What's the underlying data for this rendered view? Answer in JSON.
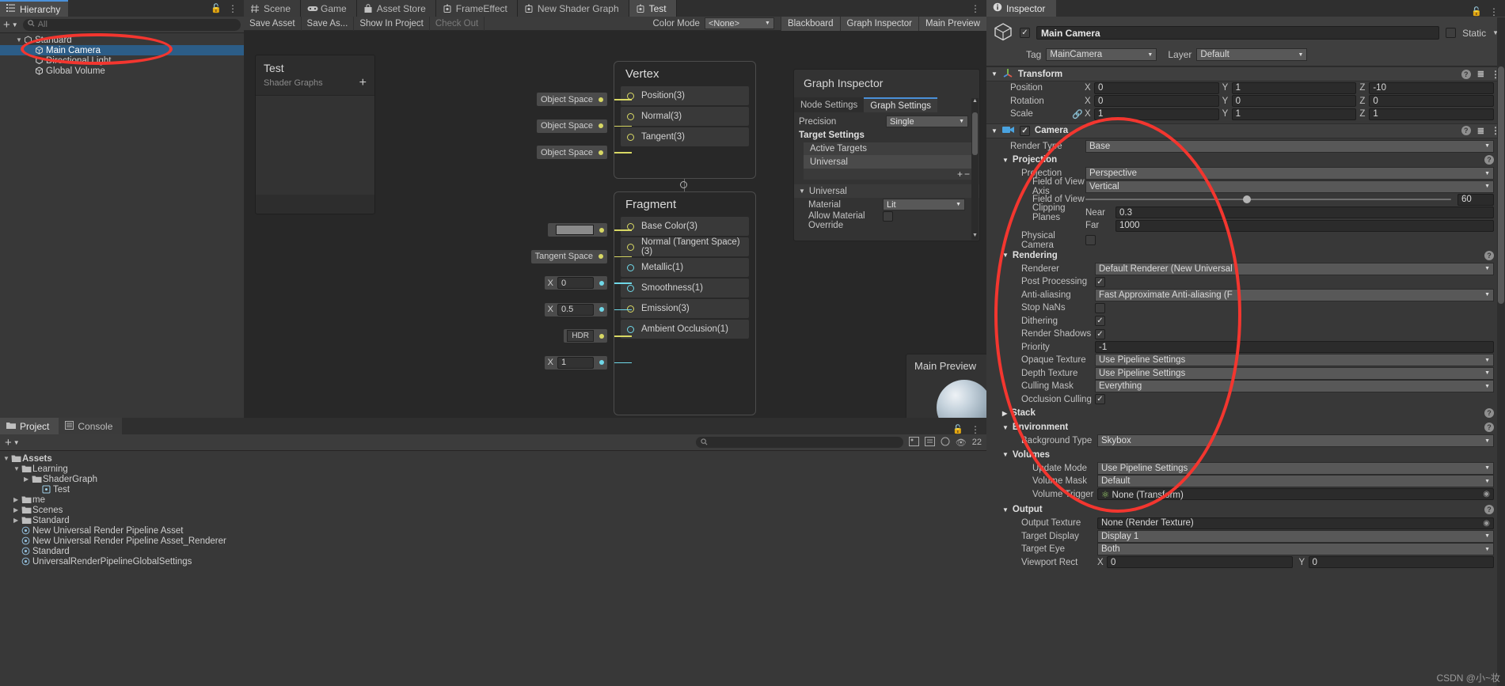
{
  "hierarchy": {
    "tab_label": "Hierarchy",
    "search_placeholder": "All",
    "add_label": "+",
    "items": [
      {
        "label": "Standard",
        "depth": 0,
        "icon": "scene-icon",
        "expanded": true,
        "selected": false
      },
      {
        "label": "Main Camera",
        "depth": 1,
        "icon": "gameobject-icon",
        "expanded": false,
        "selected": true
      },
      {
        "label": "Directional Light",
        "depth": 1,
        "icon": "light-icon",
        "expanded": false,
        "selected": false
      },
      {
        "label": "Global Volume",
        "depth": 1,
        "icon": "gameobject-icon",
        "expanded": false,
        "selected": false
      }
    ]
  },
  "editor_tabs": [
    {
      "label": "Scene",
      "icon": "scene-icon",
      "active": false
    },
    {
      "label": "Game",
      "icon": "game-icon",
      "active": false
    },
    {
      "label": "Asset Store",
      "icon": "store-icon",
      "active": false
    },
    {
      "label": "FrameEffect",
      "icon": "shadergraph-icon",
      "active": false
    },
    {
      "label": "New Shader Graph",
      "icon": "shadergraph-icon",
      "active": false
    },
    {
      "label": "Test",
      "icon": "shadergraph-icon",
      "active": true
    }
  ],
  "shadergraph": {
    "toolbar": {
      "save_asset": "Save Asset",
      "save_as": "Save As...",
      "show_in_project": "Show In Project",
      "check_out": "Check Out",
      "color_mode_label": "Color Mode",
      "color_mode_value": "<None>",
      "blackboard_toggle": "Blackboard",
      "graph_inspector_toggle": "Graph Inspector",
      "main_preview_toggle": "Main Preview"
    },
    "blackboard": {
      "title": "Test",
      "subtitle": "Shader Graphs",
      "add_label": "+"
    },
    "vertex_node": {
      "title": "Vertex",
      "ports": [
        {
          "name": "Position(3)",
          "input_label": "Object Space",
          "type": "vector"
        },
        {
          "name": "Normal(3)",
          "input_label": "Object Space",
          "type": "vector"
        },
        {
          "name": "Tangent(3)",
          "input_label": "Object Space",
          "type": "vector"
        }
      ]
    },
    "fragment_node": {
      "title": "Fragment",
      "ports": [
        {
          "name": "Base Color(3)",
          "input_kind": "color",
          "input_label": "",
          "type": "vector"
        },
        {
          "name": "Normal (Tangent Space)(3)",
          "input_kind": "text",
          "input_label": "Tangent Space",
          "type": "vector"
        },
        {
          "name": "Metallic(1)",
          "input_kind": "float",
          "input_label": "X",
          "value": "0",
          "type": "float"
        },
        {
          "name": "Smoothness(1)",
          "input_kind": "float",
          "input_label": "X",
          "value": "0.5",
          "type": "float"
        },
        {
          "name": "Emission(3)",
          "input_kind": "hdr",
          "input_label": "HDR",
          "type": "vector"
        },
        {
          "name": "Ambient Occlusion(1)",
          "input_kind": "float",
          "input_label": "X",
          "value": "1",
          "type": "float"
        }
      ]
    },
    "graph_inspector": {
      "title": "Graph Inspector",
      "tabs": [
        {
          "label": "Node Settings",
          "active": false
        },
        {
          "label": "Graph Settings",
          "active": true
        }
      ],
      "precision_label": "Precision",
      "precision_value": "Single",
      "target_settings_label": "Target Settings",
      "active_targets_label": "Active Targets",
      "active_target_value": "Universal",
      "add_btn": "+",
      "remove_btn": "−",
      "universal_section": "Universal",
      "material_label": "Material",
      "material_value": "Lit",
      "allow_material_override_label": "Allow Material Override"
    },
    "main_preview": {
      "title": "Main Preview"
    }
  },
  "project": {
    "tabs": [
      {
        "label": "Project",
        "icon": "folder-icon",
        "active": true
      },
      {
        "label": "Console",
        "icon": "console-icon",
        "active": false
      }
    ],
    "add_label": "+",
    "search_placeholder": "",
    "count_badge": "22",
    "tree": [
      {
        "label": "Assets",
        "depth": 0,
        "kind": "folder",
        "expanded": true,
        "bold": true
      },
      {
        "label": "Learning",
        "depth": 1,
        "kind": "folder",
        "expanded": true,
        "bold": false
      },
      {
        "label": "ShaderGraph",
        "depth": 2,
        "kind": "folder",
        "expanded": false,
        "bold": false
      },
      {
        "label": "Test",
        "depth": 3,
        "kind": "shader",
        "expanded": false,
        "bold": false
      },
      {
        "label": "me",
        "depth": 1,
        "kind": "folder",
        "expanded": false,
        "bold": false
      },
      {
        "label": "Scenes",
        "depth": 1,
        "kind": "folder",
        "expanded": false,
        "bold": false
      },
      {
        "label": "Standard",
        "depth": 1,
        "kind": "folder",
        "expanded": false,
        "bold": false
      },
      {
        "label": "New Universal Render Pipeline Asset",
        "depth": 1,
        "kind": "asset",
        "expanded": false,
        "bold": false
      },
      {
        "label": "New Universal Render Pipeline Asset_Renderer",
        "depth": 1,
        "kind": "asset",
        "expanded": false,
        "bold": false
      },
      {
        "label": "Standard",
        "depth": 1,
        "kind": "asset",
        "expanded": false,
        "bold": false
      },
      {
        "label": "UniversalRenderPipelineGlobalSettings",
        "depth": 1,
        "kind": "asset",
        "expanded": false,
        "bold": false
      }
    ]
  },
  "inspector": {
    "tab_label": "Inspector",
    "object_name": "Main Camera",
    "static_label": "Static",
    "tag_label": "Tag",
    "tag_value": "MainCamera",
    "layer_label": "Layer",
    "layer_value": "Default",
    "transform": {
      "header": "Transform",
      "rows": [
        {
          "label": "Position",
          "x": "0",
          "y": "1",
          "z": "-10"
        },
        {
          "label": "Rotation",
          "x": "0",
          "y": "0",
          "z": "0"
        },
        {
          "label": "Scale",
          "x": "1",
          "y": "1",
          "z": "1"
        }
      ],
      "axis_x": "X",
      "axis_y": "Y",
      "axis_z": "Z"
    },
    "camera": {
      "header": "Camera",
      "render_type_label": "Render Type",
      "render_type_value": "Base",
      "projection_section": "Projection",
      "projection_label": "Projection",
      "projection_value": "Perspective",
      "fov_axis_label": "Field of View Axis",
      "fov_axis_value": "Vertical",
      "fov_label": "Field of View",
      "fov_value": "60",
      "clipping_label": "Clipping Planes",
      "near_label": "Near",
      "near_value": "0.3",
      "far_label": "Far",
      "far_value": "1000",
      "physical_camera_label": "Physical Camera",
      "physical_camera_checked": false,
      "rendering_section": "Rendering",
      "renderer_label": "Renderer",
      "renderer_value": "Default Renderer (New Universal",
      "post_processing_label": "Post Processing",
      "post_processing_checked": true,
      "antialiasing_label": "Anti-aliasing",
      "antialiasing_value": "Fast Approximate Anti-aliasing (F",
      "stop_nans_label": "Stop NaNs",
      "stop_nans_checked": false,
      "dithering_label": "Dithering",
      "dithering_checked": true,
      "render_shadows_label": "Render Shadows",
      "render_shadows_checked": true,
      "priority_label": "Priority",
      "priority_value": "-1",
      "opaque_texture_label": "Opaque Texture",
      "opaque_texture_value": "Use Pipeline Settings",
      "depth_texture_label": "Depth Texture",
      "depth_texture_value": "Use Pipeline Settings",
      "culling_mask_label": "Culling Mask",
      "culling_mask_value": "Everything",
      "occlusion_culling_label": "Occlusion Culling",
      "occlusion_culling_checked": true,
      "stack_section": "Stack",
      "environment_section": "Environment",
      "background_type_label": "Background Type",
      "background_type_value": "Skybox",
      "volumes_section": "Volumes",
      "update_mode_label": "Update Mode",
      "update_mode_value": "Use Pipeline Settings",
      "volume_mask_label": "Volume Mask",
      "volume_mask_value": "Default",
      "volume_trigger_label": "Volume Trigger",
      "volume_trigger_value": "None (Transform)",
      "output_section": "Output",
      "output_texture_label": "Output Texture",
      "output_texture_value": "None (Render Texture)",
      "target_display_label": "Target Display",
      "target_display_value": "Display 1",
      "target_eye_label": "Target Eye",
      "target_eye_value": "Both",
      "viewport_rect_label": "Viewport Rect",
      "viewport_x": "0",
      "viewport_y": "0"
    }
  },
  "watermark": "CSDN @小~妆",
  "colors": {
    "accent_blue": "#4a90d9",
    "selection_blue": "#2c5d87",
    "annotation_red": "#f3362f",
    "vector_port": "#d8d864",
    "float_port": "#6fd8e8"
  }
}
